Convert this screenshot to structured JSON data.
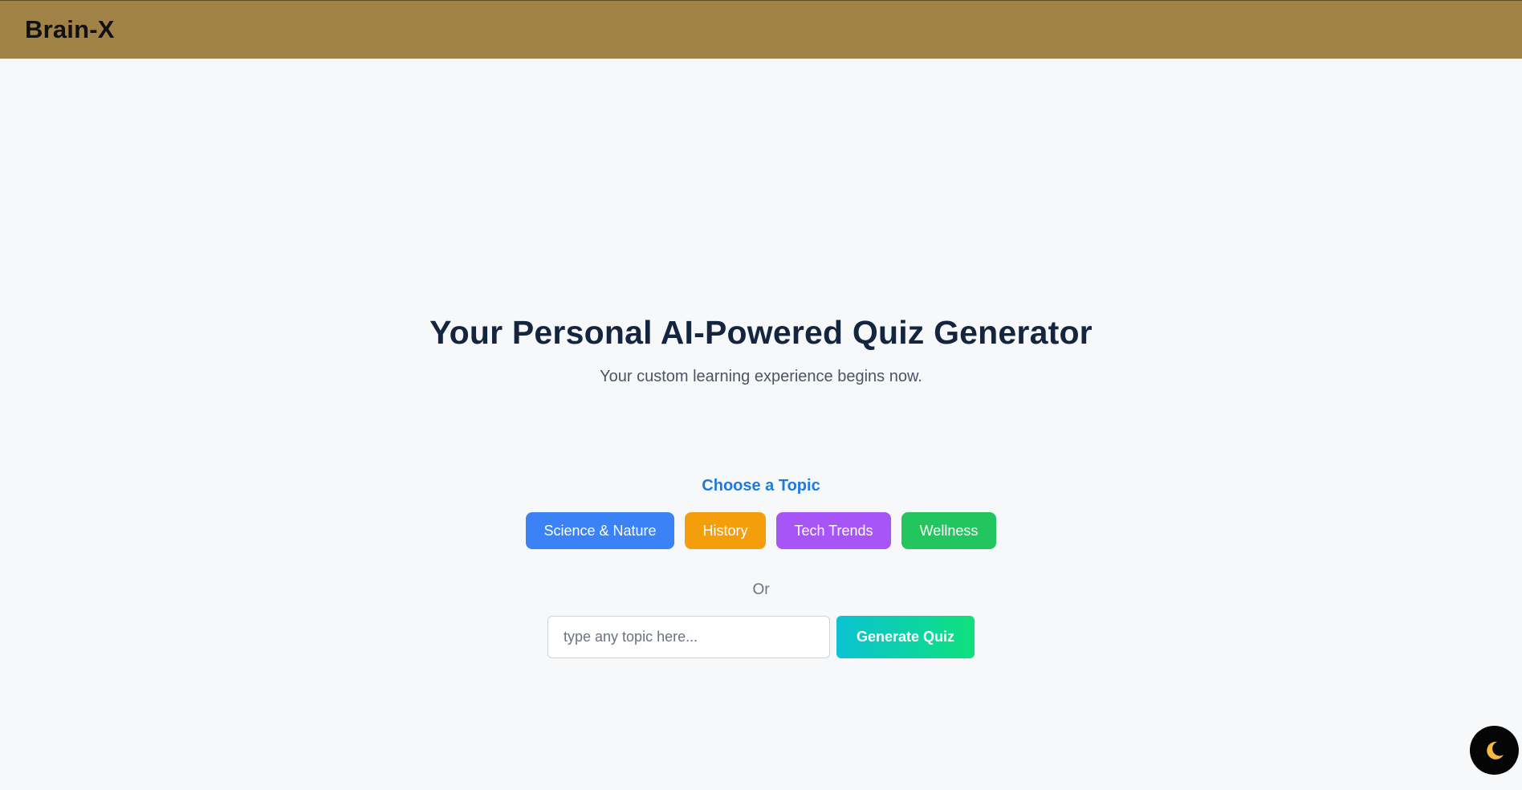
{
  "header": {
    "brand": "Brain-X",
    "background_color": "#a08246"
  },
  "hero": {
    "title": "Your Personal AI-Powered Quiz Generator",
    "subtitle": "Your custom learning experience begins now."
  },
  "topics": {
    "heading": "Choose a Topic",
    "items": [
      {
        "label": "Science & Nature",
        "color": "#3b82f6"
      },
      {
        "label": "History",
        "color": "#f59e0b"
      },
      {
        "label": "Tech Trends",
        "color": "#a855f7"
      },
      {
        "label": "Wellness",
        "color": "#22c55e"
      }
    ]
  },
  "separator": "Or",
  "custom": {
    "placeholder": "type any topic here...",
    "value": "",
    "generate_label": "Generate Quiz"
  },
  "theme_toggle": {
    "icon": "moon-icon"
  }
}
